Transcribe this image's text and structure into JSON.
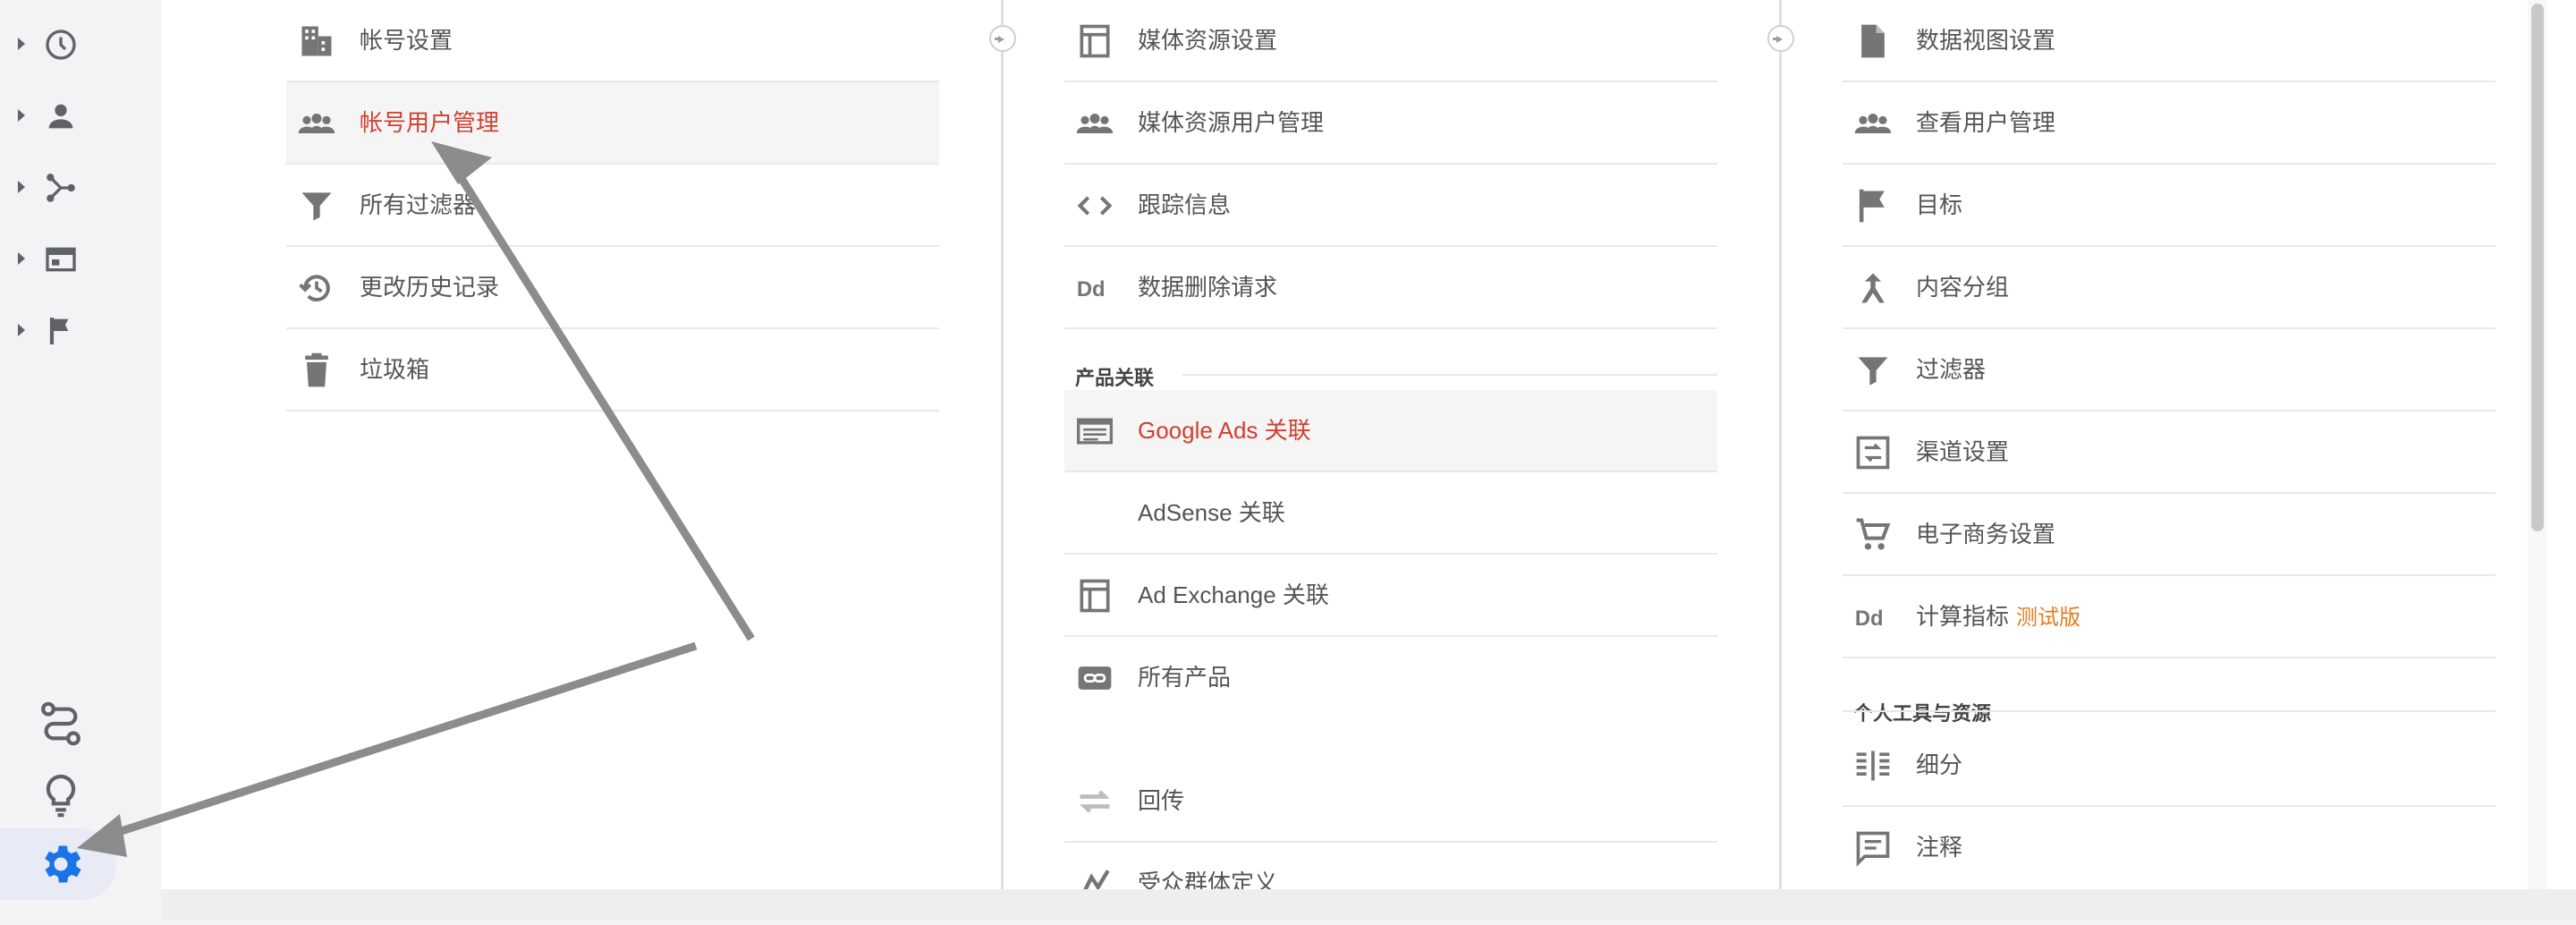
{
  "rail": {
    "items": [
      {
        "icon": "clock-icon"
      },
      {
        "icon": "person-icon"
      },
      {
        "icon": "fork-icon"
      },
      {
        "icon": "browser-icon"
      },
      {
        "icon": "flag-icon"
      }
    ],
    "bottom": [
      {
        "icon": "route-icon"
      },
      {
        "icon": "lightbulb-icon"
      },
      {
        "icon": "gear-icon",
        "active": true
      }
    ],
    "accent_color": "#1a73e8"
  },
  "account": {
    "items": [
      {
        "icon": "building-icon",
        "label": "帐号设置"
      },
      {
        "icon": "users-icon",
        "label": "帐号用户管理",
        "active": true
      },
      {
        "icon": "filter-icon",
        "label": "所有过滤器"
      },
      {
        "icon": "history-icon",
        "label": "更改历史记录"
      },
      {
        "icon": "trash-icon",
        "label": "垃圾箱"
      }
    ]
  },
  "property": {
    "items": [
      {
        "icon": "layout-icon",
        "label": "媒体资源设置"
      },
      {
        "icon": "users-icon",
        "label": "媒体资源用户管理"
      },
      {
        "icon": "code-icon",
        "label": "跟踪信息"
      },
      {
        "icon": "dd-icon",
        "label": "数据删除请求"
      }
    ],
    "section_label": "产品关联",
    "links": [
      {
        "icon": "ads-icon",
        "label": "Google Ads 关联",
        "active": true
      },
      {
        "icon": "",
        "label": "AdSense 关联"
      },
      {
        "icon": "layout-icon",
        "label": "Ad Exchange 关联"
      },
      {
        "icon": "link-icon",
        "label": "所有产品"
      },
      {
        "icon": "postback-icon",
        "label": "回传"
      },
      {
        "icon": "audience-icon",
        "label": "受众群体定义"
      }
    ]
  },
  "view": {
    "items": [
      {
        "icon": "document-icon",
        "label": "数据视图设置"
      },
      {
        "icon": "users-icon",
        "label": "查看用户管理"
      },
      {
        "icon": "flag-icon",
        "label": "目标"
      },
      {
        "icon": "grouping-icon",
        "label": "内容分组"
      },
      {
        "icon": "filter-icon",
        "label": "过滤器"
      },
      {
        "icon": "channel-icon",
        "label": "渠道设置"
      },
      {
        "icon": "cart-icon",
        "label": "电子商务设置"
      },
      {
        "icon": "dd-icon",
        "label": "计算指标",
        "badge": "测试版"
      }
    ],
    "section_label": "个人工具与资源",
    "tools": [
      {
        "icon": "segment-icon",
        "label": "细分"
      },
      {
        "icon": "comment-icon",
        "label": "注释"
      }
    ]
  },
  "colors": {
    "active_text": "#d23f31",
    "beta": "#e67c22",
    "arrow": "#8c8c8c"
  }
}
